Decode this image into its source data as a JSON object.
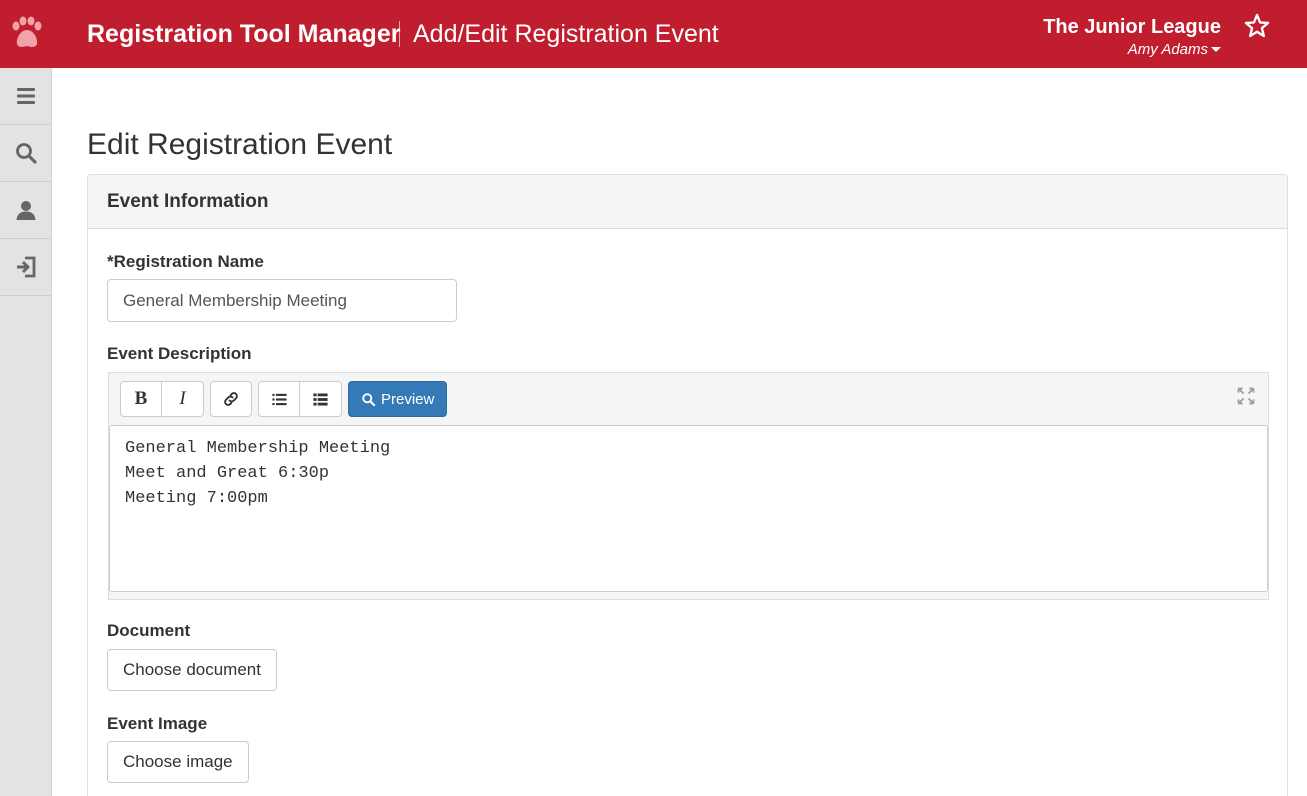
{
  "header": {
    "app_title": "Registration Tool Manager",
    "page_subtitle": "Add/Edit Registration Event",
    "org_name": "The Junior League",
    "user_name": "Amy Adams",
    "brand_color": "#c01e2e",
    "brand_icon": "paw-icon",
    "favorite_icon": "star-icon"
  },
  "sidebar": {
    "items": [
      {
        "icon": "menu-icon"
      },
      {
        "icon": "search-icon"
      },
      {
        "icon": "user-icon"
      },
      {
        "icon": "sign-out-icon"
      }
    ]
  },
  "main": {
    "heading": "Edit Registration Event",
    "panel_title": "Event Information",
    "registration_name": {
      "label": "*Registration Name",
      "value": "General Membership Meeting"
    },
    "event_description": {
      "label": "Event Description",
      "toolbar": {
        "bold": "B",
        "italic": "I",
        "preview": "Preview"
      },
      "content": "General Membership Meeting\nMeet and Great 6:30p\nMeeting 7:00pm"
    },
    "document": {
      "label": "Document",
      "button": "Choose document"
    },
    "event_image": {
      "label": "Event Image",
      "button": "Choose image"
    }
  }
}
